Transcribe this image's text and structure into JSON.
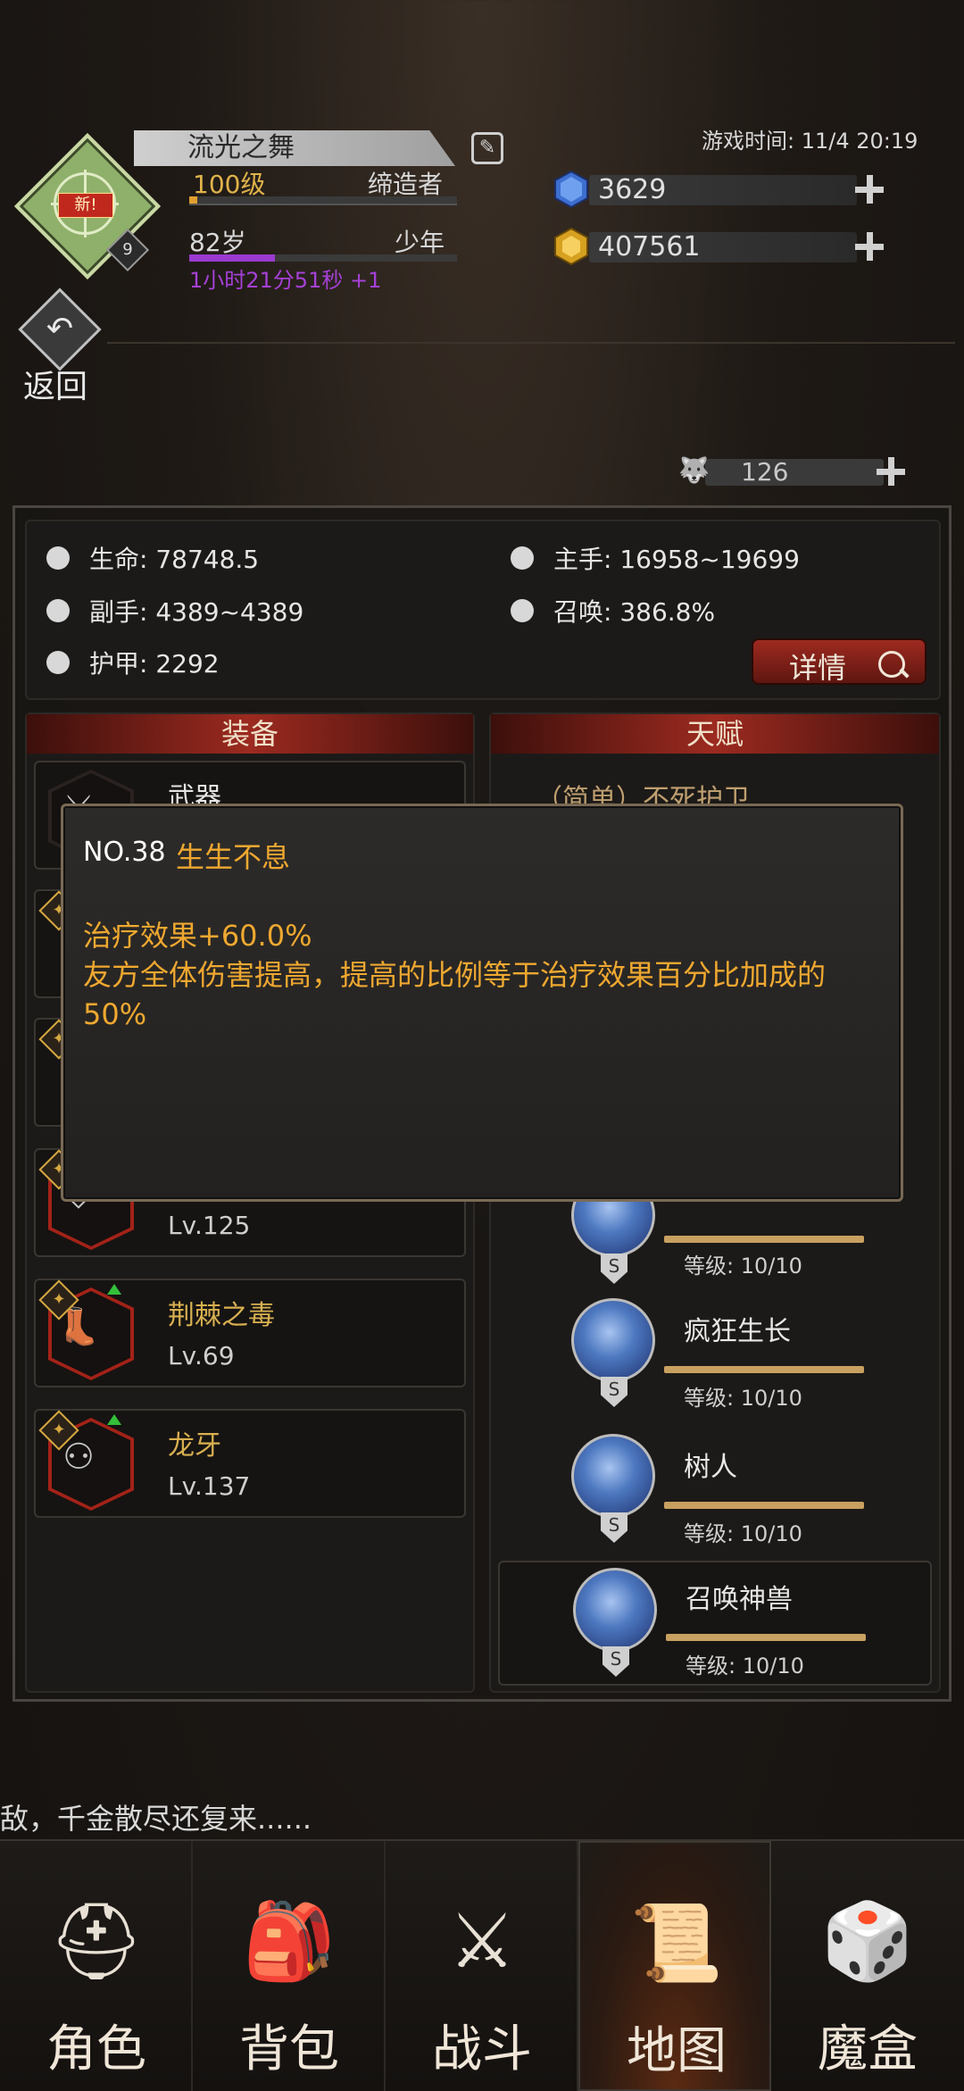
{
  "header": {
    "avatar_badge": "新!",
    "avatar_number": "9",
    "player_name": "流光之舞",
    "level": "100级",
    "class_title": "缔造者",
    "age": "82岁",
    "age_stage": "少年",
    "timer": "1小时21分51秒 +1",
    "exp_progress": 0.03,
    "age_progress": 0.32,
    "game_time": "游戏时间: 11/4 20:19",
    "gem_count": "3629",
    "gold_count": "407561",
    "back_label": "返回",
    "stamina": "126"
  },
  "stats": {
    "hp": "生命: 78748.5",
    "main_hand": "主手: 16958~19699",
    "off_hand": "副手: 4389~4389",
    "summon": "召唤: 386.8%",
    "armor": "护甲: 2292",
    "details_button": "详情"
  },
  "equipment": {
    "header": "装备",
    "items": [
      {
        "name": "武器",
        "level": ""
      },
      {
        "name": "",
        "level": "Lv.125"
      },
      {
        "name": "荆棘之毒",
        "level": "Lv.69"
      },
      {
        "name": "龙牙",
        "level": "Lv.137"
      }
    ]
  },
  "talents": {
    "header": "天赋",
    "hidden_row": "（简单）不死护卫",
    "rows": [
      {
        "name": "",
        "level": "等级: 10/10"
      },
      {
        "name": "疯狂生长",
        "level": "等级: 10/10"
      },
      {
        "name": "树人",
        "level": "等级: 10/10"
      },
      {
        "name": "召唤神兽",
        "level": "等级: 10/10"
      }
    ]
  },
  "tooltip": {
    "number": "NO.38",
    "title": "生生不息",
    "line1": "治疗效果+60.0%",
    "line2": "友方全体伤害提高，提高的比例等于治疗效果百分比加成的",
    "line3": "50%"
  },
  "marquee": "敌，千金散尽还复来......",
  "nav": [
    {
      "label": "角色",
      "icon": "helmet-icon"
    },
    {
      "label": "背包",
      "icon": "backpack-icon"
    },
    {
      "label": "战斗",
      "icon": "sword-shield-icon"
    },
    {
      "label": "地图",
      "icon": "scroll-map-icon"
    },
    {
      "label": "魔盒",
      "icon": "magic-box-icon"
    }
  ],
  "colors": {
    "accent_gold": "#f0a830",
    "details_red": "#9e2a20",
    "talent_blue": "#4d78c0",
    "timer_purple": "#a640d8"
  }
}
